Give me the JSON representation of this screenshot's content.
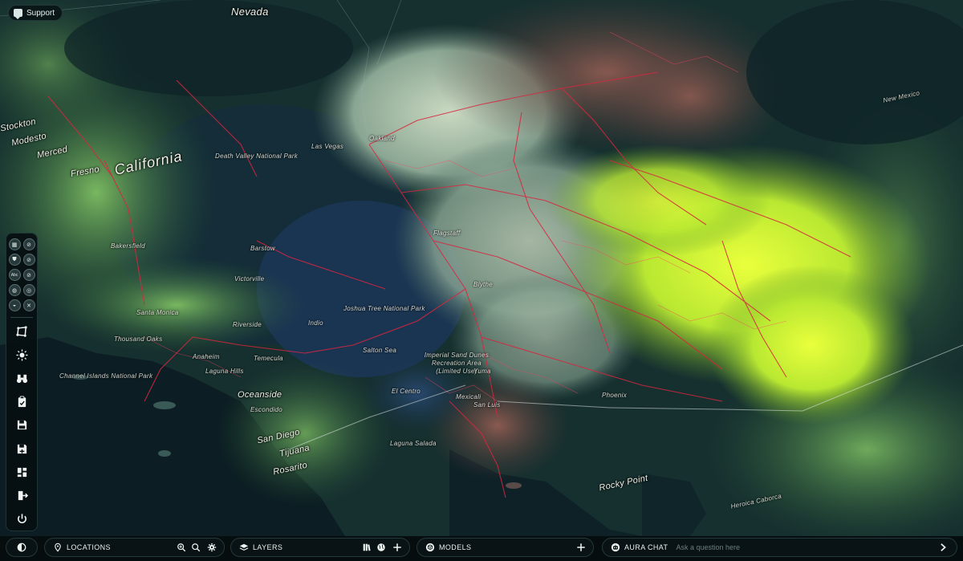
{
  "support": {
    "label": "Support",
    "icon": "chat-bubble-icon"
  },
  "map": {
    "labels": {
      "nevada": "Nevada",
      "california": "California",
      "fresno": "Fresno",
      "modesto": "Modesto",
      "merced": "Merced",
      "bakersfield": "Bakersfield",
      "stockton": "Stockton",
      "oakland": "Oakland",
      "victorville": "Victorville",
      "anaheim": "Anaheim",
      "oceanside": "Oceanside",
      "escondido": "Escondido",
      "san_diego": "San Diego",
      "tijuana": "Tijuana",
      "rosarito": "Rosarito",
      "el_centro": "El Centro",
      "mexicali": "Mexicali",
      "yuma": "Yuma",
      "san_luis": "San Luis",
      "rocky_point": "Rocky Point",
      "heroica_caborca": "Heroica Caborca",
      "new_mexico": "New Mexico",
      "imperial_sand": "Imperial Sand Dunes Recreation Area (Limited Use)",
      "joshua_tree": "Joshua Tree National Park",
      "death_valley": "Death Valley National Park",
      "channel_islands": "Channel Islands National Park",
      "salton_sea": "Salton Sea",
      "laguna_salada": "Laguna Salada",
      "laguna_hills": "Laguna Hills",
      "temecula": "Temecula",
      "thousand_oaks": "Thousand Oaks",
      "santa_monica": "Santa Monica",
      "riverside": "Riverside",
      "barstow": "Barstow",
      "indio": "Indio",
      "blythe": "Blythe",
      "las_vegas": "Las Vegas",
      "flagstaff": "Flagstaff",
      "phoenix": "Phoenix"
    },
    "colors": {
      "ocean": "#0e2227",
      "land_dark": "#1c3b3a",
      "vegetation": "#6fae5a",
      "highlight": "#d8f23a",
      "roads": "#d8263f"
    }
  },
  "rail": {
    "toggles": [
      [
        "building-icon",
        "hide-icon"
      ],
      [
        "shield-icon",
        "hide-icon"
      ],
      [
        "abc-label-icon",
        "hide-icon"
      ],
      [
        "globe-icon",
        "globe-icon"
      ],
      [
        "terrain-icon",
        "tools-icon"
      ]
    ],
    "toggle_text": {
      "abc": "Abc"
    },
    "buttons": [
      "polygon-draw-icon",
      "sun-icon",
      "binoculars-icon",
      "clipboard-icon",
      "save-icon",
      "save-as-icon",
      "dashboard-icon",
      "logout-icon",
      "power-icon"
    ]
  },
  "bottom": {
    "locations_label": "LOCATIONS",
    "layers_label": "LAYERS",
    "models_label": "MODELS",
    "chat_label": "AURA CHAT",
    "chat_placeholder": "Ask a question here"
  }
}
